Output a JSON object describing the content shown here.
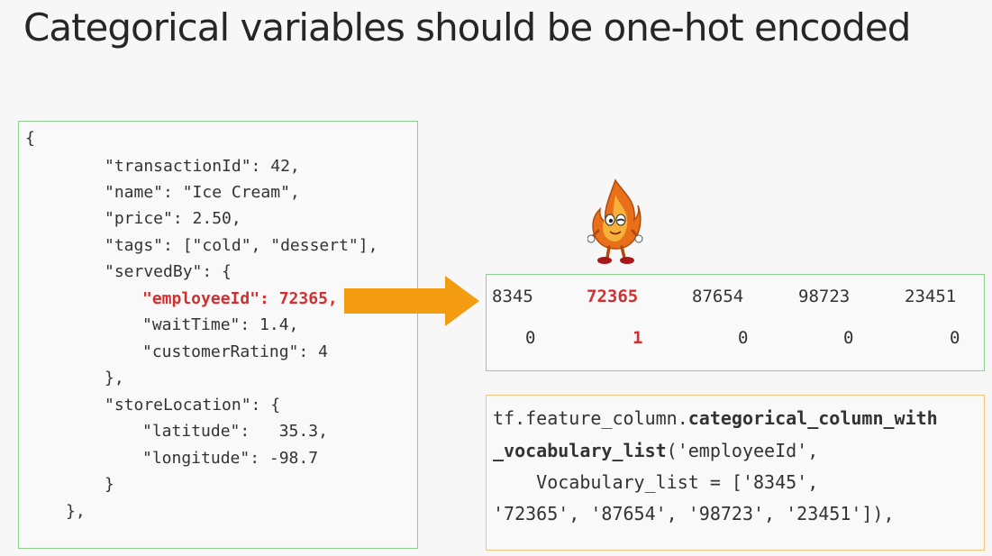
{
  "slide": {
    "title": "Categorical variables should be one-hot encoded"
  },
  "json_example": {
    "lines": [
      "{",
      "\"transactionId\": 42,",
      "\"name\": \"Ice Cream\",",
      "\"price\": 2.50,",
      "\"tags\": [\"cold\", \"dessert\"],",
      "\"servedBy\": {",
      "\"employeeId\": 72365,",
      "\"waitTime\": 1.4,",
      "\"customerRating\": 4",
      "},",
      "\"storeLocation\": {",
      "\"latitude\":   35.3,",
      "\"longitude\": -98.7",
      "}",
      "},"
    ]
  },
  "one_hot": {
    "vocabulary": [
      "8345",
      "72365",
      "87654",
      "98723",
      "23451"
    ],
    "encoding": [
      "0",
      "1",
      "0",
      "0",
      "0"
    ],
    "highlight_index": 1
  },
  "code": {
    "line1_prefix": "tf.feature_column.",
    "line1_bold": "categorical_column_with",
    "line2_bold": "_vocabulary_list",
    "line2_rest": "('employeeId',",
    "line3": "    Vocabulary_list = ['8345',",
    "line4": "'72365', '87654', '98723', '23451']),"
  },
  "colors": {
    "highlight": "#d32f2f",
    "arrow": "#f39c12",
    "green_border": "#8ecf8e",
    "orange_border": "#f4c27a"
  },
  "icons": {
    "arrow": "right-arrow-icon",
    "mascot": "flame-mascot-icon"
  }
}
